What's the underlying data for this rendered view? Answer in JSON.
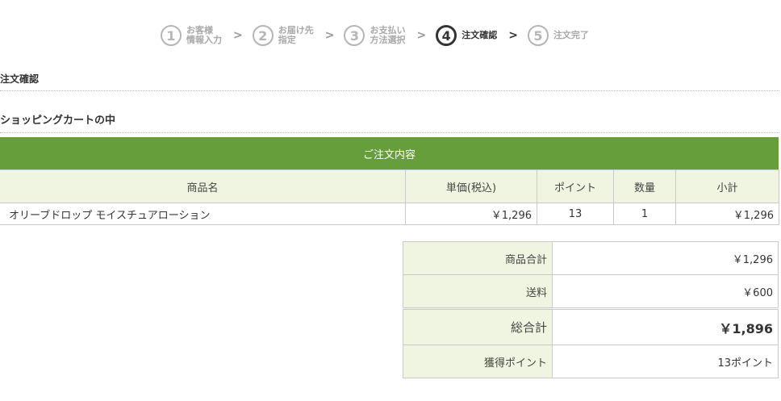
{
  "steps": [
    {
      "number": "1",
      "line1": "お客様",
      "line2": "情報入力",
      "active": false
    },
    {
      "number": "2",
      "line1": "お届け先",
      "line2": "指定",
      "active": false
    },
    {
      "number": "3",
      "line1": "お支払い",
      "line2": "方法選択",
      "active": false
    },
    {
      "number": "4",
      "line1": "注文確認",
      "line2": "",
      "active": true
    },
    {
      "number": "5",
      "line1": "注文完了",
      "line2": "",
      "active": false
    }
  ],
  "step_separator": ">",
  "headings": {
    "confirm": "注文確認",
    "cart": "ショッピングカートの中"
  },
  "order": {
    "banner": "ご注文内容",
    "columns": [
      "商品名",
      "単価(税込)",
      "ポイント",
      "数量",
      "小計"
    ],
    "rows": [
      {
        "name": "オリーブドロップ モイスチュアローション",
        "price": "￥1,296",
        "points": "13",
        "qty": "1",
        "subtotal": "￥1,296"
      }
    ]
  },
  "totals": {
    "items": [
      {
        "label": "商品合計",
        "value": "￥1,296"
      },
      {
        "label": "送料",
        "value": "￥600"
      },
      {
        "label": "総合計",
        "value": "￥1,896"
      },
      {
        "label": "獲得ポイント",
        "value": "13ポイント"
      }
    ]
  },
  "colors": {
    "banner": "#669e3c",
    "header_bg": "#f0f5e1",
    "border": "#c9c9c9"
  }
}
